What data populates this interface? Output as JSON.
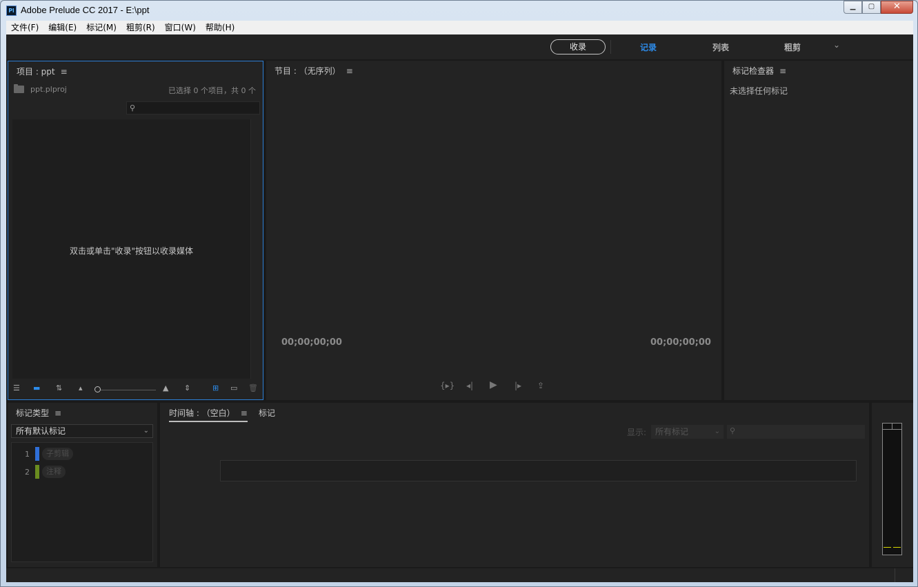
{
  "window": {
    "title": "Adobe Prelude CC 2017 - E:\\ppt",
    "app_icon_text": "Pl",
    "controls": [
      "minimize-icon",
      "maximize-icon",
      "close-icon"
    ]
  },
  "menubar": {
    "items": [
      "文件(F)",
      "编辑(E)",
      "标记(M)",
      "粗剪(R)",
      "窗口(W)",
      "帮助(H)"
    ]
  },
  "header": {
    "ingest_label": "收录",
    "workspaces": [
      {
        "label": "记录",
        "active": true
      },
      {
        "label": "列表",
        "active": false
      },
      {
        "label": "粗剪",
        "active": false
      }
    ],
    "accent_color": "#2d8ceb"
  },
  "project_panel": {
    "title": "项目 : ppt",
    "file_name": "ppt.plproj",
    "selection_status": "已选择 0 个项目，共 0 个",
    "search_placeholder": "",
    "empty_hint": "双击或单击\"收录\"按钮以收录媒体",
    "tools": [
      "list-view-icon",
      "icon-view-icon",
      "sort-icon",
      "zoom-out-icon",
      "zoom-in-icon",
      "expand-icon",
      "new-bin-icon",
      "folder-icon",
      "trash-icon"
    ]
  },
  "program_panel": {
    "title": "节目 : （无序列）",
    "timecode_left": "00;00;00;00",
    "timecode_right": "00;00;00;00",
    "transport": [
      "mark-in-out-icon",
      "step-back-icon",
      "play-icon",
      "step-forward-icon",
      "export-frame-icon"
    ]
  },
  "inspector_panel": {
    "title": "标记检查器",
    "message": "未选择任何标记"
  },
  "marker_types_panel": {
    "title": "标记类型",
    "filter_value": "所有默认标记",
    "items": [
      {
        "num": "1",
        "label": "子剪辑",
        "color": "#2f6fd8"
      },
      {
        "num": "2",
        "label": "注释",
        "color": "#6a8c1f"
      }
    ]
  },
  "timeline_panel": {
    "tabs": [
      {
        "label": "时间轴 : （空白）",
        "active": true
      },
      {
        "label": "标记",
        "active": false
      }
    ],
    "show_label": "显示:",
    "show_value": "所有标记",
    "search_placeholder": ""
  }
}
